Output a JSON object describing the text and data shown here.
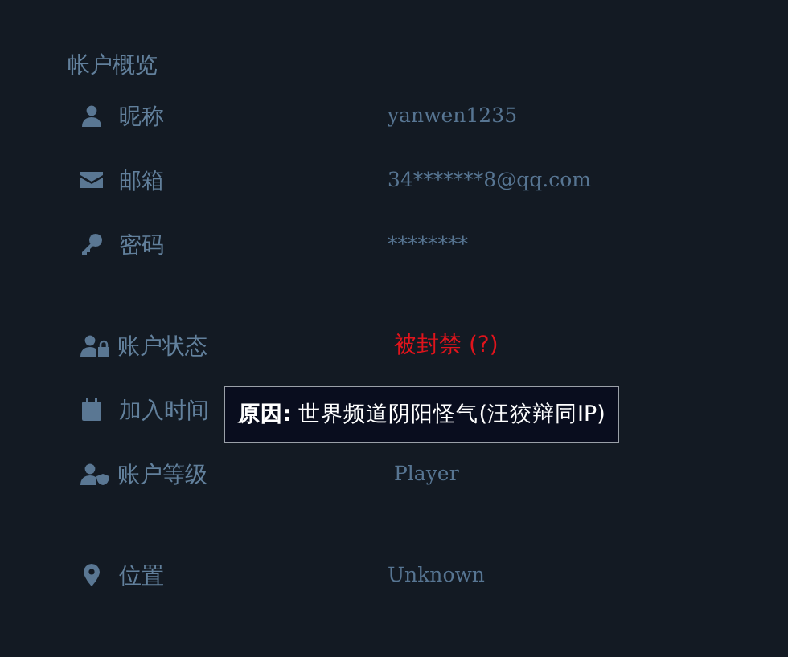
{
  "section_title": "帐户概览",
  "groups": [
    {
      "rows": [
        {
          "kind": "user",
          "label": "昵称",
          "value": "yanwen1235"
        },
        {
          "kind": "mail",
          "label": "邮箱",
          "value": "34*******8@qq.com"
        },
        {
          "kind": "key",
          "label": "密码",
          "value": "********"
        }
      ]
    },
    {
      "rows": [
        {
          "kind": "user-lock",
          "label": "账户状态",
          "value": "被封禁 (?)",
          "alert": true
        },
        {
          "kind": "calendar",
          "label": "加入时间"
        },
        {
          "kind": "user-shield",
          "label": "账户等级",
          "value": "Player"
        }
      ]
    },
    {
      "rows": [
        {
          "kind": "pin",
          "label": "位置",
          "value": "Unknown"
        }
      ]
    }
  ],
  "tooltip": {
    "text": "**原因:** 世界频道阴阳怪气(汪狡辩同IP)"
  }
}
